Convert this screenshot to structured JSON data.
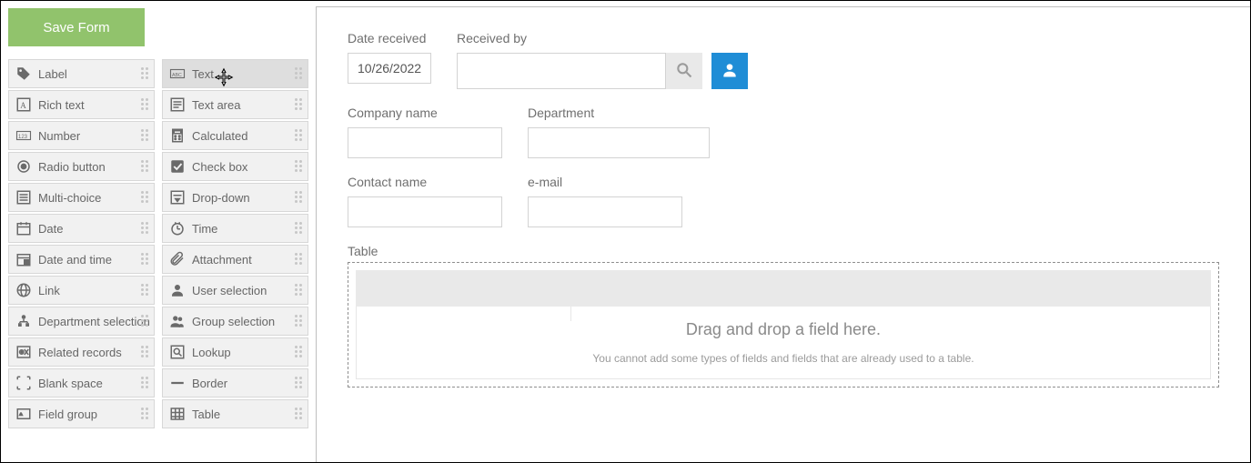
{
  "header": {
    "save_label": "Save Form"
  },
  "palette": {
    "left": [
      {
        "icon": "tag",
        "label": "Label"
      },
      {
        "icon": "richtext",
        "label": "Rich text"
      },
      {
        "icon": "number",
        "label": "Number"
      },
      {
        "icon": "radio",
        "label": "Radio button"
      },
      {
        "icon": "multi",
        "label": "Multi-choice"
      },
      {
        "icon": "date",
        "label": "Date"
      },
      {
        "icon": "datetime",
        "label": "Date and time"
      },
      {
        "icon": "link",
        "label": "Link"
      },
      {
        "icon": "deptsel",
        "label": "Department selection"
      },
      {
        "icon": "related",
        "label": "Related records"
      },
      {
        "icon": "blank",
        "label": "Blank space"
      },
      {
        "icon": "fieldgrp",
        "label": "Field group"
      }
    ],
    "right": [
      {
        "icon": "text",
        "label": "Text",
        "dragging": true
      },
      {
        "icon": "textarea",
        "label": "Text area"
      },
      {
        "icon": "calc",
        "label": "Calculated"
      },
      {
        "icon": "checkbox",
        "label": "Check box"
      },
      {
        "icon": "dropdown",
        "label": "Drop-down"
      },
      {
        "icon": "time",
        "label": "Time"
      },
      {
        "icon": "attach",
        "label": "Attachment"
      },
      {
        "icon": "usersel",
        "label": "User selection"
      },
      {
        "icon": "groupsel",
        "label": "Group selection"
      },
      {
        "icon": "lookup",
        "label": "Lookup"
      },
      {
        "icon": "border",
        "label": "Border"
      },
      {
        "icon": "table",
        "label": "Table"
      }
    ]
  },
  "form": {
    "date_received": {
      "label": "Date received",
      "value": "10/26/2022"
    },
    "received_by": {
      "label": "Received by",
      "value": "",
      "placeholder": ""
    },
    "company_name": {
      "label": "Company name",
      "value": ""
    },
    "department": {
      "label": "Department",
      "value": ""
    },
    "contact_name": {
      "label": "Contact name",
      "value": ""
    },
    "email": {
      "label": "e-mail",
      "value": ""
    }
  },
  "table": {
    "title": "Table",
    "drop_big": "Drag and drop a field here.",
    "drop_small": "You cannot add some types of fields and fields that are already used to a table."
  },
  "icons": {
    "search": "search-icon",
    "user": "user-icon"
  }
}
